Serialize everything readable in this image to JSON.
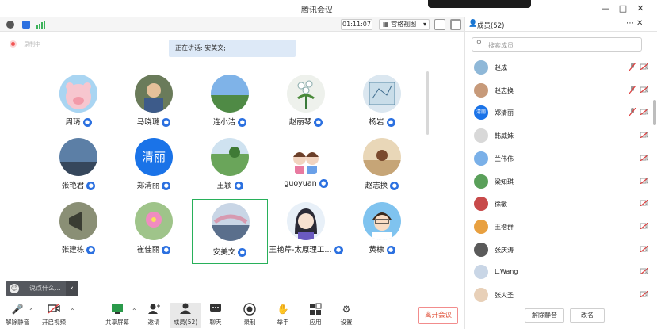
{
  "window": {
    "title": "腾讯会议",
    "controls": [
      "minimize-icon",
      "maximize-icon",
      "close-icon"
    ]
  },
  "infobar": {
    "timer": "01:11:07",
    "view_mode": "宫格视图",
    "icons": [
      "info-icon",
      "shield-icon",
      "signal-icon"
    ]
  },
  "main": {
    "recording_label": "录制中",
    "speaking_text": "正在讲话: 安美文;",
    "participants": [
      {
        "name": "周琦",
        "avatar": "pig"
      },
      {
        "name": "马晓璐",
        "avatar": "child"
      },
      {
        "name": "连小洁",
        "avatar": "landscape"
      },
      {
        "name": "赵丽琴",
        "avatar": "flowers"
      },
      {
        "name": "杨岩",
        "avatar": "map"
      },
      {
        "name": "张艳君",
        "avatar": "sky"
      },
      {
        "name": "郑清丽",
        "avatar": "text-avatar",
        "avatar_text": "清丽"
      },
      {
        "name": "王颖",
        "avatar": "park"
      },
      {
        "name": "guoyuan",
        "avatar": "cartoon"
      },
      {
        "name": "赵志换",
        "avatar": "beach"
      },
      {
        "name": "张建栋",
        "avatar": "speaker"
      },
      {
        "name": "崔佳丽",
        "avatar": "pink-flower"
      },
      {
        "name": "安美文",
        "avatar": "blossom",
        "active": true
      },
      {
        "name": "王艳芹-太原理工...",
        "avatar": "anime-girl"
      },
      {
        "name": "黄棣",
        "avatar": "anime-boy"
      }
    ],
    "chat_placeholder": "说点什么..."
  },
  "toolbar": {
    "items": [
      {
        "label": "解除静音",
        "icon": "mic-off-icon"
      },
      {
        "label": "开启视频",
        "icon": "camera-off-icon"
      },
      {
        "label": "共享屏幕",
        "icon": "share-screen-icon"
      },
      {
        "label": "邀请",
        "icon": "invite-icon"
      },
      {
        "label": "成员(52)",
        "icon": "members-icon"
      },
      {
        "label": "聊天",
        "icon": "chat-icon"
      },
      {
        "label": "录制",
        "icon": "record-icon"
      },
      {
        "label": "举手",
        "icon": "hand-icon"
      },
      {
        "label": "应用",
        "icon": "apps-icon"
      },
      {
        "label": "设置",
        "icon": "settings-icon"
      }
    ],
    "leave_label": "离开会议"
  },
  "panel": {
    "title": "成员(52)",
    "search_placeholder": "搜索成员",
    "members": [
      {
        "name": "赵成"
      },
      {
        "name": "赵志换"
      },
      {
        "name": "郑清丽",
        "avatar_text": "清丽"
      },
      {
        "name": "韩威妹"
      },
      {
        "name": "兰伟伟"
      },
      {
        "name": "梁知琪"
      },
      {
        "name": "徐敏"
      },
      {
        "name": "王楷群"
      },
      {
        "name": "张庆涛"
      },
      {
        "name": "L.Wang"
      },
      {
        "name": "张火圣"
      }
    ],
    "unmute_all_label": "解除静音",
    "rename_label": "改名"
  },
  "colors": {
    "accent": "#2b70e0",
    "active_border": "#28b05a",
    "leave": "#e0533c"
  }
}
